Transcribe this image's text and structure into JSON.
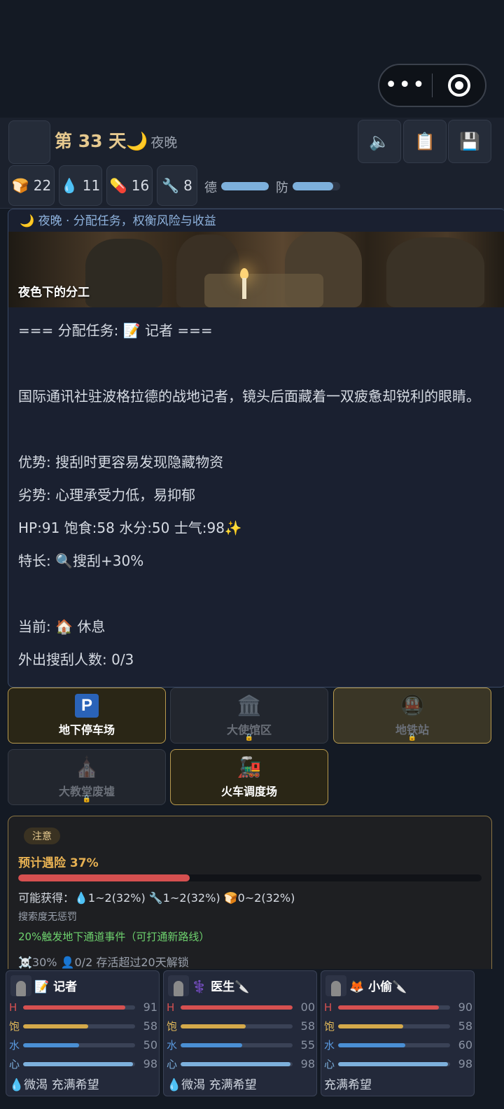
{
  "system": {
    "more_icon": "more-dots",
    "close_icon": "target-circle"
  },
  "header": {
    "menu_icon": "",
    "day_label": "第 33 天",
    "phase_icon": "🌙",
    "phase_label": "夜晚",
    "sound_icon": "🔈",
    "log_icon": "📋",
    "save_icon": "💾"
  },
  "resources": [
    {
      "icon": "🍞",
      "value": "22"
    },
    {
      "icon": "💧",
      "value": "11"
    },
    {
      "icon": "💊",
      "value": "16"
    },
    {
      "icon": "🔧",
      "value": "8"
    }
  ],
  "bars": {
    "morality": {
      "label": "德",
      "fraction": 1.0
    },
    "defense": {
      "label": "防",
      "fraction": 0.85
    }
  },
  "event": {
    "subtitle": "🌙 夜晚 · 分配任务，权衡风险与收益",
    "image_caption": "夜色下的分工",
    "lines": [
      "===  分配任务: 📝 记者  ===",
      "",
      "国际通讯社驻波格拉德的战地记者，镜头后面藏着一双疲惫却锐利的眼睛。",
      "优势: 搜刮时更容易发现隐藏物资",
      "劣势: 心理承受力低，易抑郁",
      "HP:91  饱食:58  水分:50  士气:98✨",
      "特长: 🔍搜刮+30%",
      "",
      "当前: 🏠 休息",
      "外出搜刮人数: 0/3"
    ]
  },
  "locations": [
    {
      "name": "地下停车场",
      "icon": "P",
      "locked": false
    },
    {
      "name": "大使馆区",
      "icon": "🏛️",
      "locked": true,
      "lock_icon": "🔒"
    },
    {
      "name": "地铁站",
      "icon": "🚇",
      "locked": true,
      "lock_icon": "🔒"
    },
    {
      "name": "大教堂废墟",
      "icon": "⛪",
      "locked": true,
      "lock_icon": "🔒"
    },
    {
      "name": "火车调度场",
      "icon": "🚂",
      "locked": false
    }
  ],
  "risk": {
    "badge": "注意",
    "title": "预计遇险 37%",
    "fraction": 0.37,
    "loot": "可能获得：💧1~2(32%)  🔧1~2(32%)  🍞0~2(32%)",
    "search_note": "搜索度无惩罚",
    "event_note": "20%触发地下通道事件（可打通新路线）",
    "footer": "☠️30%  👤0/2  存活超过20天解锁"
  },
  "team": [
    {
      "name": "📝 记者",
      "stats": [
        {
          "key": "H",
          "value": "91",
          "fraction": 0.91
        },
        {
          "key": "饱",
          "value": "58",
          "fraction": 0.58
        },
        {
          "key": "水",
          "value": "50",
          "fraction": 0.5
        },
        {
          "key": "心",
          "value": "98",
          "fraction": 0.98
        }
      ],
      "status": "💧微渴  充满希望"
    },
    {
      "name": "⚕️ 医生🔪",
      "stats": [
        {
          "key": "H",
          "value": "00",
          "fraction": 1.0
        },
        {
          "key": "饱",
          "value": "58",
          "fraction": 0.58
        },
        {
          "key": "水",
          "value": "55",
          "fraction": 0.55
        },
        {
          "key": "心",
          "value": "98",
          "fraction": 0.98
        }
      ],
      "status": "💧微渴  充满希望"
    },
    {
      "name": "🦊 小偷🔪",
      "stats": [
        {
          "key": "H",
          "value": "90",
          "fraction": 0.9
        },
        {
          "key": "饱",
          "value": "58",
          "fraction": 0.58
        },
        {
          "key": "水",
          "value": "60",
          "fraction": 0.6
        },
        {
          "key": "心",
          "value": "98",
          "fraction": 0.98
        }
      ],
      "status": "充满希望"
    }
  ],
  "colors": {
    "gold": "#e6c98f",
    "hp": "#d65050",
    "food": "#d4a94a",
    "water": "#4a8fd4",
    "mind": "#7db0dc",
    "risk": "#d65050",
    "good": "#6ed26e"
  }
}
